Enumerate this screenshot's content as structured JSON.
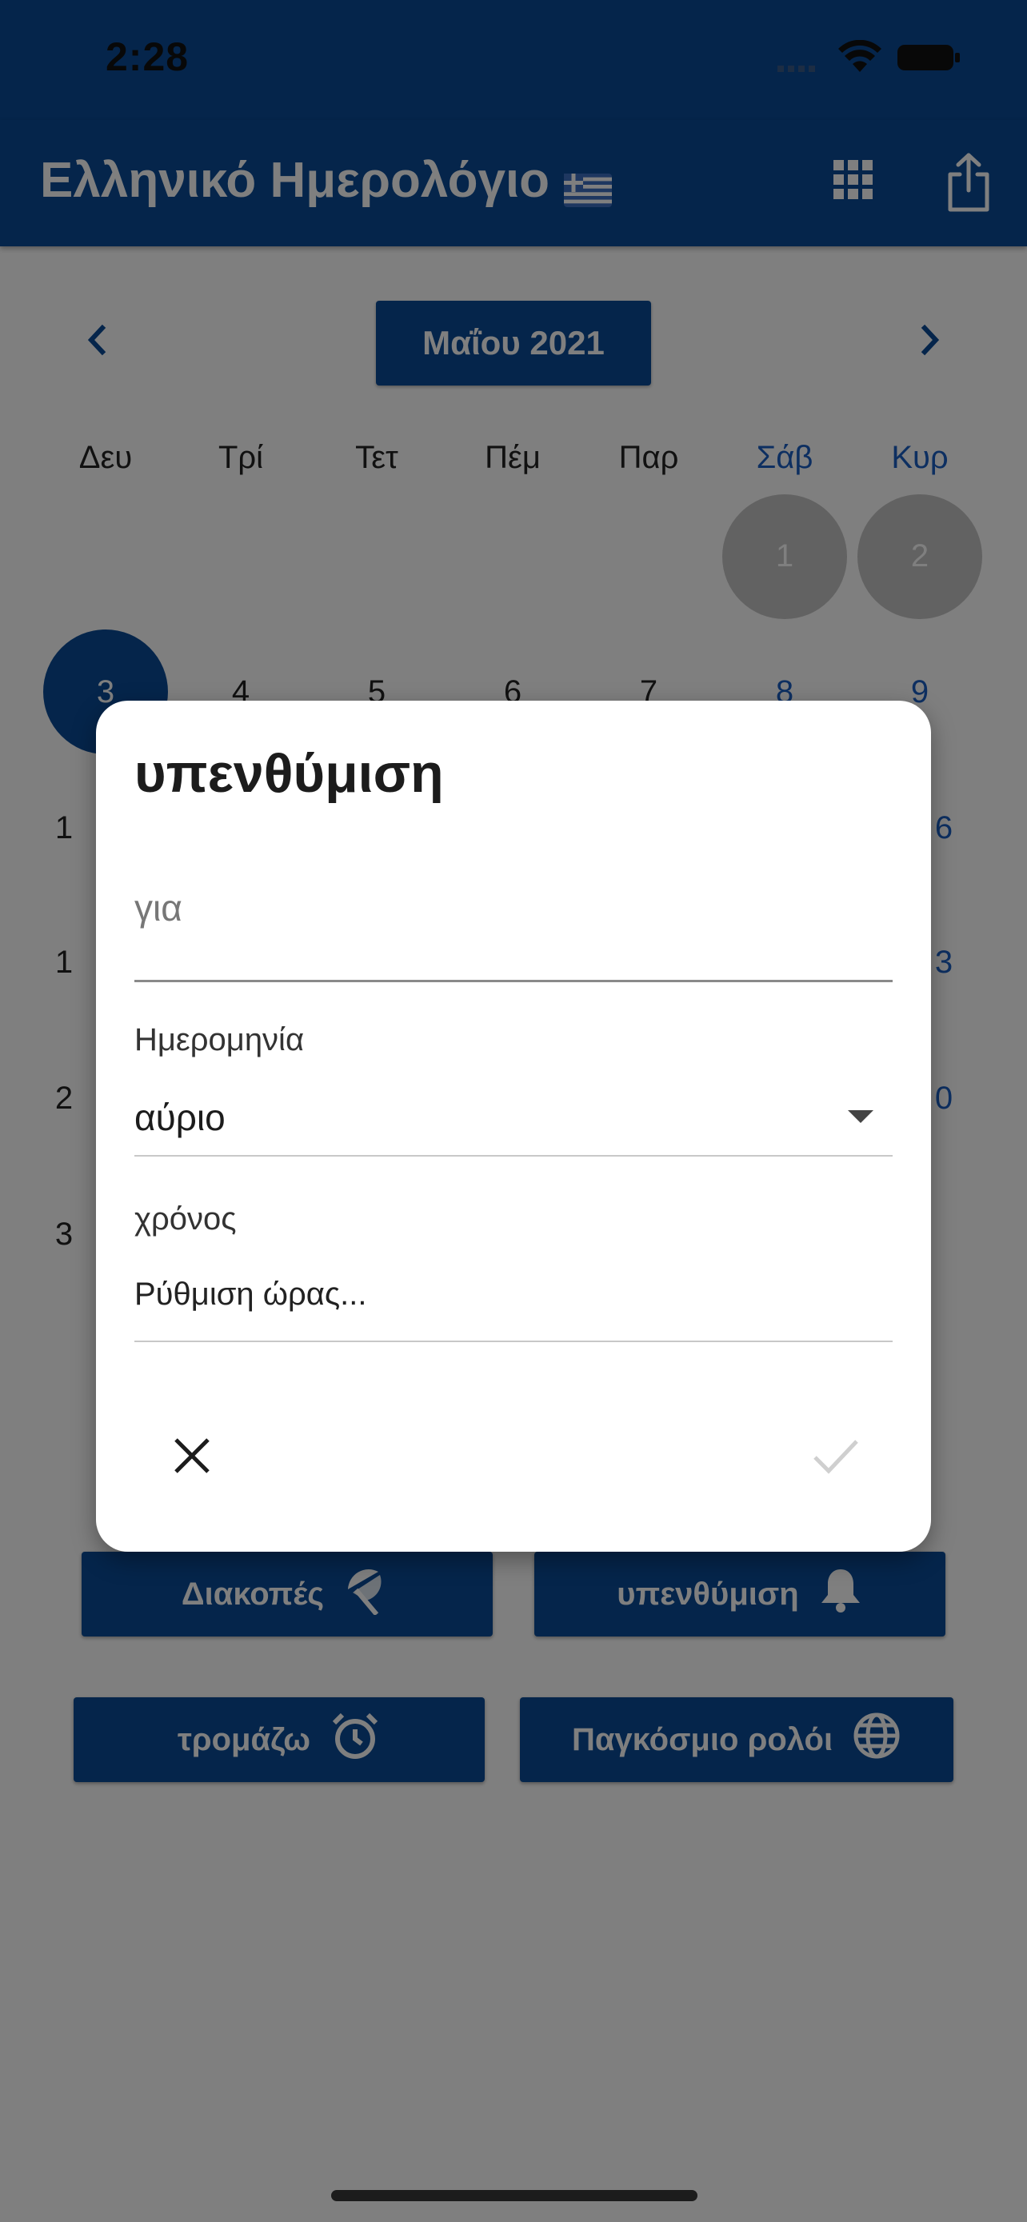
{
  "status_bar": {
    "time": "2:28"
  },
  "app_bar": {
    "title": "Ελληνικό Ημερολόγιο"
  },
  "calendar": {
    "month_label": "Μαΐου 2021",
    "weekdays": [
      "Δευ",
      "Τρί",
      "Τετ",
      "Πέμ",
      "Παρ",
      "Σάβ",
      "Κυρ"
    ],
    "visible_days": [
      "1",
      "2",
      "3",
      "4",
      "5",
      "6",
      "7",
      "8",
      "9"
    ],
    "partial_row_edges": {
      "row3_left": "1",
      "row3_right": "6",
      "row4_left": "1",
      "row4_right": "3",
      "row5_left": "2",
      "row5_right": "0",
      "row6_left": "3"
    }
  },
  "actions": {
    "holidays": "Διακοπές",
    "reminder": "υπενθύμιση",
    "alarm": "τρομάζω",
    "world_clock": "Παγκόσμιο ρολόι"
  },
  "dialog": {
    "title": "υπενθύμιση",
    "for_placeholder": "για",
    "date_label": "Ημερομηνία",
    "date_value": "αύριο",
    "time_label": "χρόνος",
    "time_value": "Ρύθμιση ώρας..."
  },
  "colors": {
    "primary": "#0a4a96",
    "weekend": "#1a5ec2",
    "dialog": "#ffffff"
  }
}
